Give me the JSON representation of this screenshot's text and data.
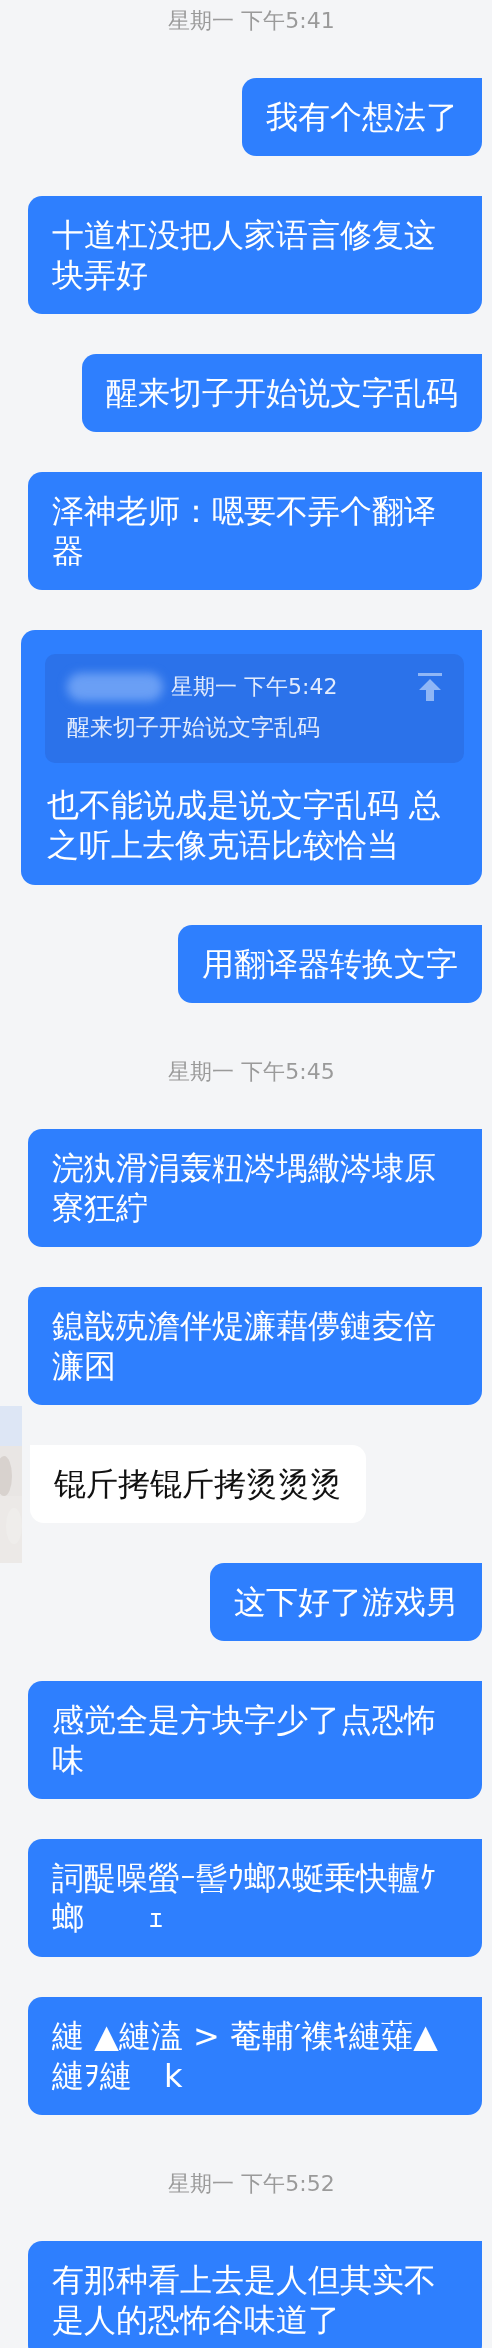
{
  "messages": [
    {
      "kind": "time",
      "text": "星期一 下午5:41"
    },
    {
      "kind": "sent",
      "text": "我有个想法了"
    },
    {
      "kind": "sent",
      "text": "十道杠没把人家语言修复这块弄好"
    },
    {
      "kind": "sent",
      "text": "醒来切子开始说文字乱码"
    },
    {
      "kind": "sent",
      "text": "泽神老师：嗯要不弄个翻译器"
    },
    {
      "kind": "sent_quote",
      "quote_time": "星期一 下午5:42",
      "quote_text": "醒来切子开始说文字乱码",
      "text": "也不能说成是说文字乱码 总之听上去像克语比较恰当"
    },
    {
      "kind": "sent",
      "text": "用翻译器转换文字"
    },
    {
      "kind": "time",
      "text": "星期一 下午5:45"
    },
    {
      "kind": "sent",
      "text": "浣犱滑涓轰粈涔堣繖涔埭原寮狂紵"
    },
    {
      "kind": "sent",
      "text": "鎴戠殑澹伴煶濂藉儚鏈夌倍濂囨"
    },
    {
      "kind": "received",
      "text": "锟斤拷锟斤拷烫烫烫"
    },
    {
      "kind": "sent",
      "text": "这下好了游戏男"
    },
    {
      "kind": "sent",
      "text": "感觉全是方块字少了点恐怖味"
    },
    {
      "kind": "sent",
      "text": "詞醍噪螢ｰ髻ｳ螂ｽ蜒乗快轤ｹ螂　　ｪ"
    },
    {
      "kind": "sent",
      "text": "縺 ▲縺溘 > 菴輔′襍ｷ縺薙▲縺ｦ縺　k"
    },
    {
      "kind": "time",
      "text": "星期一 下午5:52"
    },
    {
      "kind": "sent",
      "text": "有那种看上去是人但其实不是人的恐怖谷味道了"
    }
  ]
}
